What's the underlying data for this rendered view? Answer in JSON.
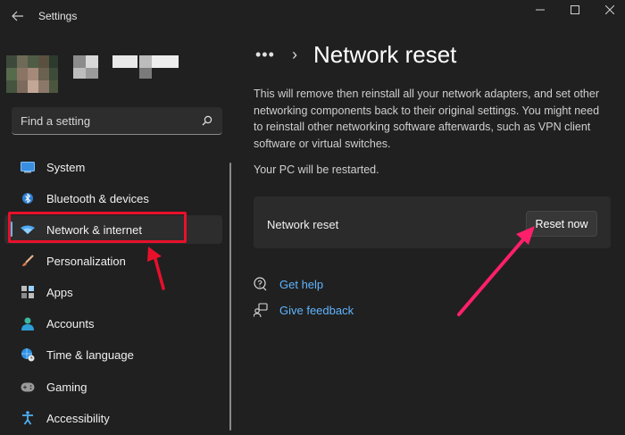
{
  "window": {
    "title": "Settings",
    "back_icon": "back-arrow-icon",
    "minimize_icon": "minimize-icon",
    "maximize_icon": "maximize-icon",
    "close_icon": "close-icon"
  },
  "search": {
    "placeholder": "Find a setting",
    "icon": "search-icon"
  },
  "sidebar": {
    "items": [
      {
        "label": "System",
        "icon": "system-icon"
      },
      {
        "label": "Bluetooth & devices",
        "icon": "bluetooth-icon"
      },
      {
        "label": "Network & internet",
        "icon": "wifi-icon",
        "selected": true
      },
      {
        "label": "Personalization",
        "icon": "brush-icon"
      },
      {
        "label": "Apps",
        "icon": "apps-icon"
      },
      {
        "label": "Accounts",
        "icon": "person-icon"
      },
      {
        "label": "Time & language",
        "icon": "globe-clock-icon"
      },
      {
        "label": "Gaming",
        "icon": "gamepad-icon"
      },
      {
        "label": "Accessibility",
        "icon": "accessibility-icon"
      }
    ]
  },
  "main": {
    "breadcrumb_more": "•••",
    "breadcrumb_sep": "›",
    "title": "Network reset",
    "description": "This will remove then reinstall all your network adapters, and set other networking components back to their original settings. You might need to reinstall other networking software afterwards, such as VPN client software or virtual switches.",
    "restart_note": "Your PC will be restarted.",
    "card": {
      "label": "Network reset",
      "button": "Reset now"
    },
    "links": [
      {
        "label": "Get help",
        "icon": "help-chat-icon"
      },
      {
        "label": "Give feedback",
        "icon": "feedback-icon"
      }
    ]
  },
  "colors": {
    "background": "#202020",
    "accent": "#4fc3f7",
    "link": "#60b4ff",
    "annotation_red": "#e8102a",
    "annotation_pink": "#ff1f6a"
  }
}
